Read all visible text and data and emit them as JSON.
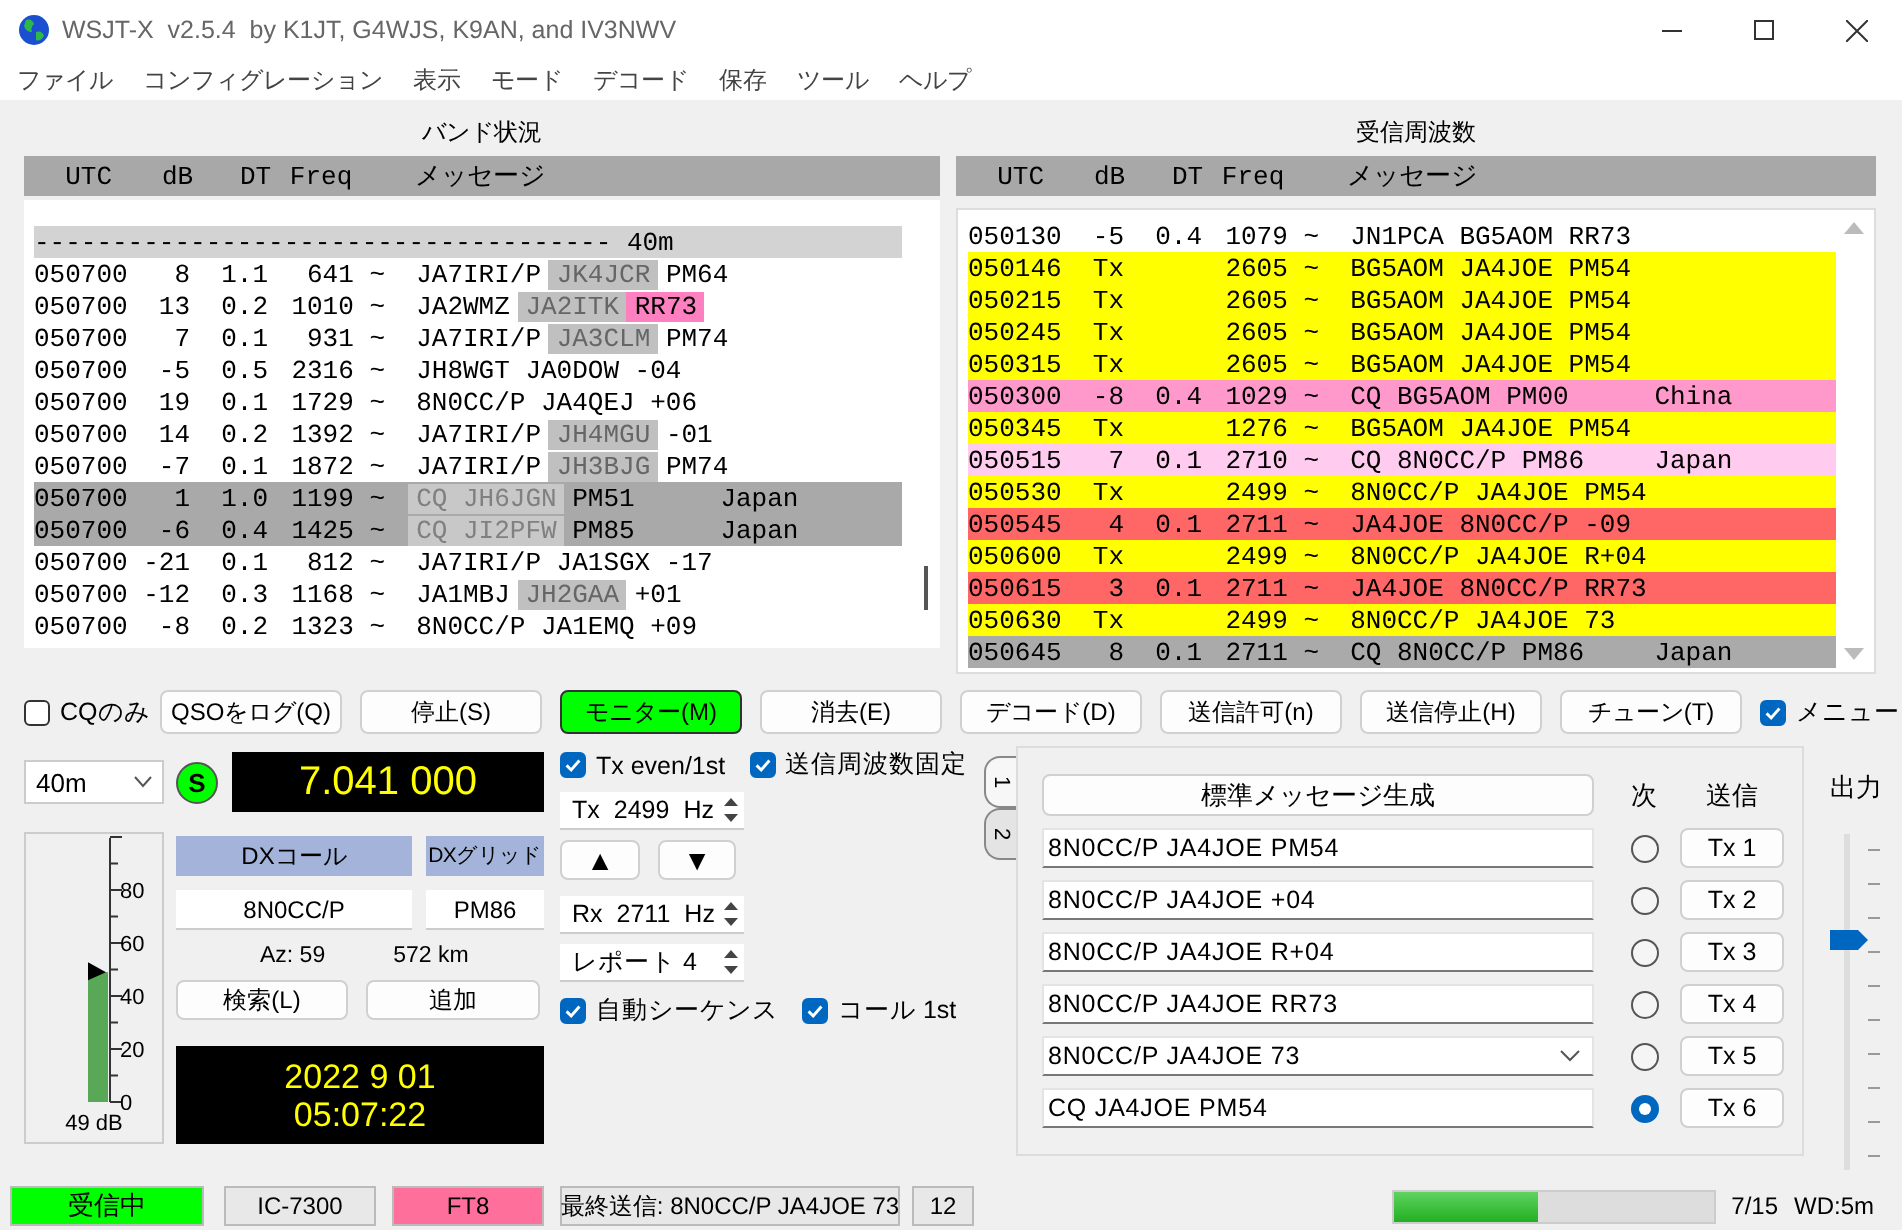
{
  "window": {
    "title": "WSJT-X  v2.5.4  by K1JT, G4WJS, K9AN, and IV3NWV"
  },
  "menu": [
    "ファイル",
    "コンフィグレーション",
    "表示",
    "モード",
    "デコード",
    "保存",
    "ツール",
    "ヘルプ"
  ],
  "band_activity": {
    "title": "バンド状況",
    "columns": [
      "UTC",
      "dB",
      "DT",
      "Freq",
      "メッセージ"
    ],
    "rows": [
      {
        "kind": "separator",
        "text": "------------------------------------- 40m"
      },
      {
        "kind": "decode",
        "utc": "050700",
        "db": "8",
        "dt": "1.1",
        "freq": "641",
        "sep": "~",
        "parts": [
          {
            "text": "JA7IRI/P",
            "kind": "plain"
          },
          {
            "text": "JK4JCR",
            "kind": "call"
          },
          {
            "text": "PM64",
            "kind": "plain"
          }
        ]
      },
      {
        "kind": "decode",
        "utc": "050700",
        "db": "13",
        "dt": "0.2",
        "freq": "1010",
        "sep": "~",
        "parts": [
          {
            "text": "JA2WMZ",
            "kind": "plain"
          },
          {
            "text": "JA2ITK",
            "kind": "call"
          },
          {
            "text": "RR73",
            "kind": "alert"
          }
        ]
      },
      {
        "kind": "decode",
        "utc": "050700",
        "db": "7",
        "dt": "0.1",
        "freq": "931",
        "sep": "~",
        "parts": [
          {
            "text": "JA7IRI/P",
            "kind": "plain"
          },
          {
            "text": "JA3CLM",
            "kind": "call"
          },
          {
            "text": "PM74",
            "kind": "plain"
          }
        ]
      },
      {
        "kind": "decode",
        "utc": "050700",
        "db": "-5",
        "dt": "0.5",
        "freq": "2316",
        "sep": "~",
        "parts": [
          {
            "text": "JH8WGT JA0DOW -04",
            "kind": "plain"
          }
        ]
      },
      {
        "kind": "decode",
        "utc": "050700",
        "db": "19",
        "dt": "0.1",
        "freq": "1729",
        "sep": "~",
        "parts": [
          {
            "text": "8N0CC/P JA4QEJ +06",
            "kind": "plain"
          }
        ]
      },
      {
        "kind": "decode",
        "utc": "050700",
        "db": "14",
        "dt": "0.2",
        "freq": "1392",
        "sep": "~",
        "parts": [
          {
            "text": "JA7IRI/P",
            "kind": "plain"
          },
          {
            "text": "JH4MGU",
            "kind": "call"
          },
          {
            "text": "-01",
            "kind": "plain"
          }
        ]
      },
      {
        "kind": "decode",
        "utc": "050700",
        "db": "-7",
        "dt": "0.1",
        "freq": "1872",
        "sep": "~",
        "parts": [
          {
            "text": "JA7IRI/P",
            "kind": "plain"
          },
          {
            "text": "JH3BJG",
            "kind": "call"
          },
          {
            "text": "PM74",
            "kind": "plain"
          }
        ]
      },
      {
        "kind": "cq",
        "utc": "050700",
        "db": "1",
        "dt": "1.0",
        "freq": "1199",
        "sep": "~",
        "parts": [
          {
            "text": "CQ JH6JGN",
            "kind": "cq"
          },
          {
            "text": "PM51",
            "kind": "plain"
          }
        ],
        "country": "Japan"
      },
      {
        "kind": "cq",
        "utc": "050700",
        "db": "-6",
        "dt": "0.4",
        "freq": "1425",
        "sep": "~",
        "parts": [
          {
            "text": "CQ JI2PFW",
            "kind": "cq"
          },
          {
            "text": "PM85",
            "kind": "plain"
          }
        ],
        "country": "Japan"
      },
      {
        "kind": "decode",
        "utc": "050700",
        "db": "-21",
        "dt": "0.1",
        "freq": "812",
        "sep": "~",
        "parts": [
          {
            "text": "JA7IRI/P JA1SGX -17",
            "kind": "plain"
          }
        ]
      },
      {
        "kind": "decode",
        "utc": "050700",
        "db": "-12",
        "dt": "0.3",
        "freq": "1168",
        "sep": "~",
        "parts": [
          {
            "text": "JA1MBJ",
            "kind": "plain"
          },
          {
            "text": "JH2GAA",
            "kind": "call"
          },
          {
            "text": "+01",
            "kind": "plain"
          }
        ]
      },
      {
        "kind": "decode",
        "utc": "050700",
        "db": "-8",
        "dt": "0.2",
        "freq": "1323",
        "sep": "~",
        "parts": [
          {
            "text": "8N0CC/P JA1EMQ +09",
            "kind": "plain"
          }
        ]
      }
    ]
  },
  "rx_frequency": {
    "title": "受信周波数",
    "columns": [
      "UTC",
      "dB",
      "DT",
      "Freq",
      "メッセージ"
    ],
    "rows": [
      {
        "utc": "050130",
        "db": "-5",
        "dt": "0.4",
        "freq": "1079",
        "sep": "~",
        "message": "JN1PCA BG5AOM RR73",
        "color": "#ffffff"
      },
      {
        "utc": "050146",
        "db": "Tx",
        "freq": "2605",
        "sep": "~",
        "message": "BG5AOM JA4JOE PM54",
        "color": "#ffff00"
      },
      {
        "utc": "050215",
        "db": "Tx",
        "freq": "2605",
        "sep": "~",
        "message": "BG5AOM JA4JOE PM54",
        "color": "#ffff00"
      },
      {
        "utc": "050245",
        "db": "Tx",
        "freq": "2605",
        "sep": "~",
        "message": "BG5AOM JA4JOE PM54",
        "color": "#ffff00"
      },
      {
        "utc": "050315",
        "db": "Tx",
        "freq": "2605",
        "sep": "~",
        "message": "BG5AOM JA4JOE PM54",
        "color": "#ffff00"
      },
      {
        "utc": "050300",
        "db": "-8",
        "dt": "0.4",
        "freq": "1029",
        "sep": "~",
        "message": "CQ BG5AOM PM00",
        "country": "China",
        "color": "#ff99cc"
      },
      {
        "utc": "050345",
        "db": "Tx",
        "freq": "1276",
        "sep": "~",
        "message": "BG5AOM JA4JOE PM54",
        "color": "#ffff00"
      },
      {
        "utc": "050515",
        "db": "7",
        "dt": "0.1",
        "freq": "2710",
        "sep": "~",
        "message": "CQ 8N0CC/P PM86",
        "country": "Japan",
        "color": "#ffccf0"
      },
      {
        "utc": "050530",
        "db": "Tx",
        "freq": "2499",
        "sep": "~",
        "message": "8N0CC/P JA4JOE PM54",
        "color": "#ffff00"
      },
      {
        "utc": "050545",
        "db": "4",
        "dt": "0.1",
        "freq": "2711",
        "sep": "~",
        "message": "JA4JOE 8N0CC/P -09",
        "color": "#ff6666"
      },
      {
        "utc": "050600",
        "db": "Tx",
        "freq": "2499",
        "sep": "~",
        "message": "8N0CC/P JA4JOE R+04",
        "color": "#ffff00"
      },
      {
        "utc": "050615",
        "db": "3",
        "dt": "0.1",
        "freq": "2711",
        "sep": "~",
        "message": "JA4JOE 8N0CC/P RR73",
        "color": "#ff6666"
      },
      {
        "utc": "050630",
        "db": "Tx",
        "freq": "2499",
        "sep": "~",
        "message": "8N0CC/P JA4JOE 73",
        "color": "#ffff00"
      },
      {
        "utc": "050645",
        "db": "8",
        "dt": "0.1",
        "freq": "2711",
        "sep": "~",
        "message": "CQ 8N0CC/P PM86",
        "country": "Japan",
        "color": "#aaaaaa"
      }
    ]
  },
  "controls": {
    "cq_only": {
      "label": "CQのみ",
      "checked": false
    },
    "buttons": [
      {
        "label": "QSOをログ(Q)",
        "on": false
      },
      {
        "label": "停止(S)",
        "on": false
      },
      {
        "label": "モニター(M)",
        "on": true
      },
      {
        "label": "消去(E)",
        "on": false
      },
      {
        "label": "デコード(D)",
        "on": false
      },
      {
        "label": "送信許可(n)",
        "on": false
      },
      {
        "label": "送信停止(H)",
        "on": false
      },
      {
        "label": "チューン(T)",
        "on": false
      }
    ],
    "menu_toggle": {
      "label": "メニュー",
      "checked": true
    }
  },
  "station": {
    "band": "40m",
    "meter": {
      "ticks": [
        "80",
        "60",
        "40",
        "20",
        "0"
      ],
      "level": 0.49,
      "reading": "49 dB"
    },
    "s_lamp": "S",
    "dial_frequency": "7.041 000",
    "dx_call": {
      "label": "DXコール",
      "value": "8N0CC/P"
    },
    "dx_grid": {
      "label": "DXグリッド",
      "value": "PM86"
    },
    "azimuth": "Az: 59",
    "distance": "572 km",
    "lookup_button": "検索(L)",
    "add_button": "追加",
    "clock": {
      "date": "2022 9 01",
      "time": "05:07:22"
    },
    "options": [
      {
        "label": "Tx even/1st",
        "checked": true
      },
      {
        "label": "送信周波数固定",
        "checked": true
      }
    ],
    "tx_freq": {
      "prefix": "Tx",
      "value": "2499",
      "unit": "Hz"
    },
    "up_button": "▲",
    "down_button": "▼",
    "rx_freq": {
      "prefix": "Rx",
      "value": "2711",
      "unit": "Hz"
    },
    "report": "レポート 4",
    "sequence_options": [
      {
        "label": "自動シーケンス",
        "checked": true
      },
      {
        "label": "コール 1st",
        "checked": true
      }
    ]
  },
  "messages": {
    "tabs": [
      {
        "label": "1",
        "selected": true
      },
      {
        "label": "2",
        "selected": false
      }
    ],
    "generate_button": "標準メッセージ生成",
    "next_header": "次",
    "send_header": "送信",
    "rows": [
      {
        "kind": "field",
        "text": "8N0CC/P JA4JOE PM54",
        "next": false,
        "button": "Tx 1"
      },
      {
        "kind": "field",
        "text": "8N0CC/P JA4JOE +04",
        "next": false,
        "button": "Tx 2"
      },
      {
        "kind": "field",
        "text": "8N0CC/P JA4JOE R+04",
        "next": false,
        "button": "Tx 3"
      },
      {
        "kind": "field",
        "text": "8N0CC/P JA4JOE RR73",
        "next": false,
        "button": "Tx 4"
      },
      {
        "kind": "combo",
        "text": "8N0CC/P JA4JOE 73",
        "next": false,
        "button": "Tx 5"
      },
      {
        "kind": "field",
        "text": "CQ JA4JOE PM54",
        "next": true,
        "button": "Tx 6"
      }
    ]
  },
  "output": {
    "label": "出力",
    "level": 0.7
  },
  "status_bar": {
    "state": "受信中",
    "rig": "IC-7300",
    "mode": "FT8",
    "last_tx": "最終送信: 8N0CC/P JA4JOE 73",
    "count": "12",
    "progress": {
      "level": 0.45
    },
    "period": "7/15",
    "watchdog": "WD:5m"
  }
}
